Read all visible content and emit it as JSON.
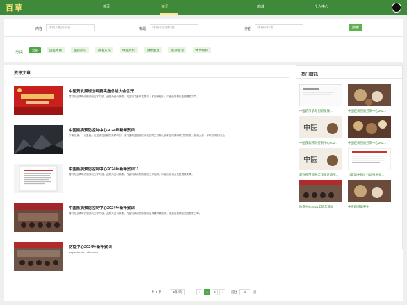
{
  "header": {
    "logo": "百草",
    "nav": [
      "首页",
      "资讯",
      "商城",
      "个人中心"
    ]
  },
  "search": {
    "content_label": "内容",
    "content_placeholder": "请输入相关内容",
    "title_label": "标题",
    "title_placeholder": "请输入资讯标题",
    "author_label": "作者",
    "author_placeholder": "请输入作者",
    "button": "搜索"
  },
  "categories": {
    "label": "分类",
    "items": [
      "全部",
      "国医精要",
      "医药知识",
      "养生方法",
      "中医文化",
      "健康生活",
      "疾病防治",
      "本草纲目"
    ]
  },
  "articles": {
    "section_title": "资讯文章",
    "items": [
      {
        "title": "中医药发展规划纲要实施总结大会召开",
        "desc": "暂时无法清晰识别该段文字内容，此处为资讯摘要，内容与中医药发展和人才培养相关，详细信息请点击查看原文章。"
      },
      {
        "title": "中国疾病预防控制中心2024年新年贺词",
        "desc": "岁聿云暮，一元复始。在这辞旧迎新的美好时刻，我们谨向全国疾控系统的同仁们致以诚挚的问候和美好的祝愿，感谢大家一年来的辛勤付出。"
      },
      {
        "title": "中国疾病预防控制中心2024年新年贺词11",
        "desc": "暂时无法清晰识别该段文字内容，此处为资讯摘要，内容与疾病预防控制工作相关，详细信息请点击查看原文章。"
      },
      {
        "title": "中国疾病预防控制中心2024年新年贺词",
        "desc": "暂时无法清晰识别该段文字内容，此处为资讯摘要，内容与疾病预防控制及健康教育相关，详细信息请点击查看原文章。"
      },
      {
        "title": "防疫中心2024年新年贺词",
        "desc": "ea paxdaestur velit et sunt"
      }
    ]
  },
  "hot": {
    "title": "热门资讯",
    "items": [
      {
        "caption": "中医药传承与创新发展..."
      },
      {
        "caption": "中国疾病预防控制中心202..."
      },
      {
        "caption": "中国疾病预防控制中心202..."
      },
      {
        "caption": "中国疾病预防控制中心202..."
      },
      {
        "caption": "新冠疫苗接种工作推进情况..."
      },
      {
        "caption": "《健康中国》行动推进会..."
      },
      {
        "caption": "防疫中心2024年新年贺词"
      },
      {
        "caption": "中医药健康养生"
      }
    ]
  },
  "pager": {
    "total": "共 8 条",
    "page_size": "5条/页",
    "prev": "‹",
    "pages": [
      "1",
      "2"
    ],
    "next": "›",
    "goto_label": "前往",
    "goto_value": "1",
    "goto_suffix": "页"
  },
  "colors": {
    "brand": "#3f8a3a",
    "accent": "#4fa646"
  }
}
